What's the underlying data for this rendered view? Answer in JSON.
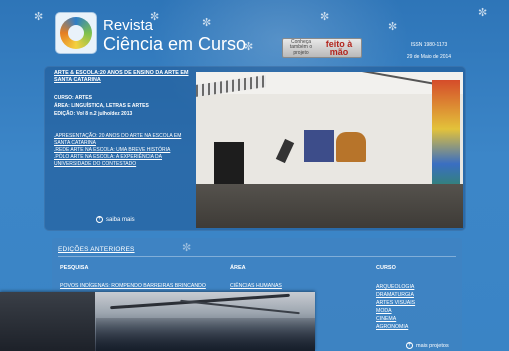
{
  "header": {
    "title_line1": "Revista",
    "title_line2": "Ciência em Curso",
    "promo_small": "Conheça também o projeto",
    "promo_big": "feito à mão",
    "issn": "ISSN 1980-1173",
    "date": "29 de Maio de 2014"
  },
  "featured": {
    "title": "ARTE & ESCOLA:20 ANOS DE ENSINO DA ARTE EM SANTA CATARINA",
    "curso_label": "CURSO:",
    "curso_value": "ARTES",
    "area_label": "ÁREA:",
    "area_value": "LINGUÍSTICA, LETRAS E ARTES",
    "edicao_label": "EDIÇÃO:",
    "edicao_value": "Vol 8 n.2 julho/dez 2013",
    "links": [
      ".APRESENTAÇÃO: 20 ANOS DO ARTE NA ESCOLA EM SANTA CATARINA",
      ".REDE ARTE NA ESCOLA: UMA BREVE HISTÓRIA",
      ".PÓLO ARTE NA ESCOLA: A EXPERIÊNCIA DA UNIVERSIDADE DO CONTESTADO"
    ],
    "saiba_mais": "saiba mais"
  },
  "previous": {
    "title": "EDIÇÕES ANTERIORES",
    "headers": {
      "pesquisa": "PESQUISA",
      "area": "ÁREA",
      "curso": "CURSO"
    },
    "pesquisa_items": [
      "POVOS INDÍGENAS: ROMPENDO BARREIRAS BRINCANDO"
    ],
    "area_items": [
      "CIÊNCIAS HUMANAS"
    ],
    "curso_items": [
      "ARQUEOLOGIA",
      "DRAMATURGIA",
      "ARTES VISUAIS",
      "MODA",
      "CINEMA",
      "AGRONOMIA"
    ],
    "mais_projetos": "mais projetos"
  },
  "icons": {
    "plus": "plus-circle-icon",
    "dandelion": "dandelion-seed-icon"
  },
  "colors": {
    "background": "#3a84c5",
    "panel": "#1e5591",
    "promo_accent": "#b3261e"
  }
}
